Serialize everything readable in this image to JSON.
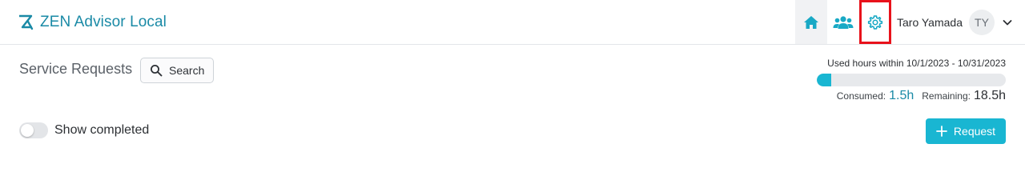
{
  "header": {
    "app_title": "ZEN Advisor Local",
    "nav": [
      {
        "name": "home",
        "icon": "home-icon",
        "active": true
      },
      {
        "name": "team",
        "icon": "users-icon",
        "active": false
      },
      {
        "name": "settings",
        "icon": "gear-icon",
        "active": false,
        "highlighted": true
      }
    ],
    "user": {
      "name": "Taro Yamada",
      "initials": "TY"
    }
  },
  "main": {
    "title": "Service Requests",
    "search_label": "Search",
    "usage": {
      "label": "Used hours within 10/1/2023 - 10/31/2023",
      "consumed_label": "Consumed:",
      "consumed_value": "1.5h",
      "remaining_label": "Remaining:",
      "remaining_value": "18.5h",
      "fraction_used": 0.075
    },
    "show_completed": {
      "label": "Show completed",
      "checked": false
    },
    "request_button": "Request"
  },
  "colors": {
    "accent": "#19b6d2",
    "brand_text": "#1a8aa6",
    "highlight": "#e8121b"
  }
}
